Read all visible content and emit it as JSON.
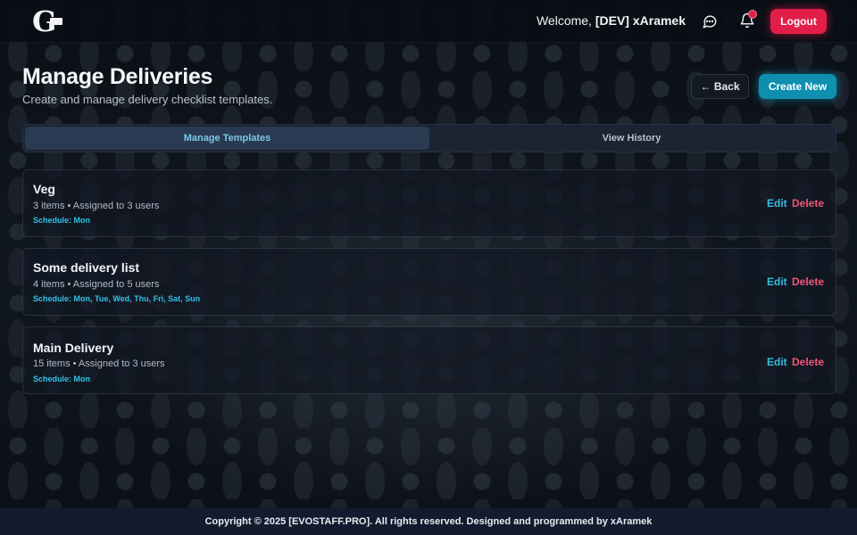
{
  "header": {
    "logo_text": "G",
    "welcome_prefix": "Welcome, ",
    "username": "[DEV] xAramek",
    "logout_label": "Logout"
  },
  "page": {
    "title": "Manage Deliveries",
    "subtitle": "Create and manage delivery checklist templates.",
    "back_label": "← Back",
    "create_label": "Create New"
  },
  "tabs": [
    {
      "label": "Manage Templates",
      "active": true
    },
    {
      "label": "View History",
      "active": false
    }
  ],
  "templates": [
    {
      "name": "Veg",
      "meta": "3 items • Assigned to 3 users",
      "schedule": "Schedule: Mon",
      "edit_label": "Edit",
      "delete_label": "Delete"
    },
    {
      "name": "Some delivery list",
      "meta": "4 items • Assigned to 5 users",
      "schedule": "Schedule: Mon, Tue, Wed, Thu, Fri, Sat, Sun",
      "edit_label": "Edit",
      "delete_label": "Delete"
    },
    {
      "name": "Main Delivery",
      "meta": "15 items • Assigned to 3 users",
      "schedule": "Schedule: Mon",
      "edit_label": "Edit",
      "delete_label": "Delete"
    }
  ],
  "footer": {
    "text": "Copyright © 2025 [EVOSTAFF.PRO]. All rights reserved. Designed and programmed by xAramek"
  },
  "icons": {
    "chat": "chat-bubble-icon",
    "bell": "bell-icon"
  },
  "colors": {
    "logout": "#e11d48",
    "create": "#0e8fb0",
    "edit": "#38bde1",
    "delete": "#f2557a",
    "schedule": "#33c1e6"
  }
}
